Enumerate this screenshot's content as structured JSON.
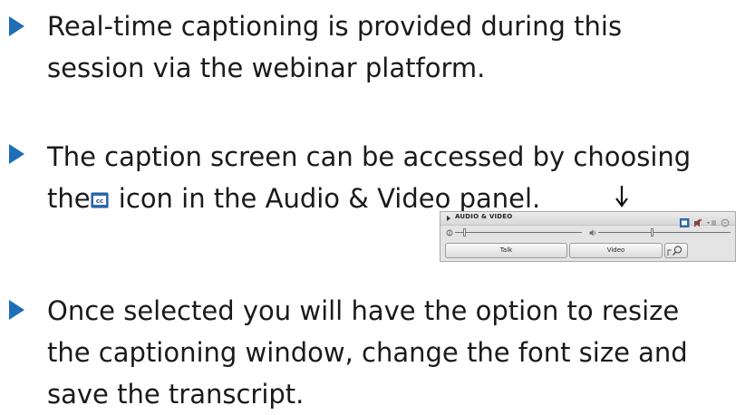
{
  "bullets": [
    {
      "line1": "Real-time captioning is provided during this",
      "line2": "session via the webinar platform."
    },
    {
      "line1": "The caption screen can be accessed by choosing",
      "line2_before": "the",
      "line2_after": " icon in the Audio & Video panel."
    },
    {
      "line1": "Once selected you will have the option to resize",
      "line2": "the captioning window, change the font size and",
      "line3": "save the transcript."
    }
  ],
  "panel": {
    "title": "AUDIO & VIDEO",
    "talk_label": "Talk",
    "video_label": "Video"
  },
  "colors": {
    "bullet_arrow": "#1e6fb5",
    "text": "#1a1a1a"
  },
  "icons": [
    "bullet-arrow-icon",
    "closed-caption-icon",
    "down-arrow-icon",
    "microphone-icon",
    "speaker-icon",
    "video-settings-icon",
    "magnifier-icon"
  ]
}
